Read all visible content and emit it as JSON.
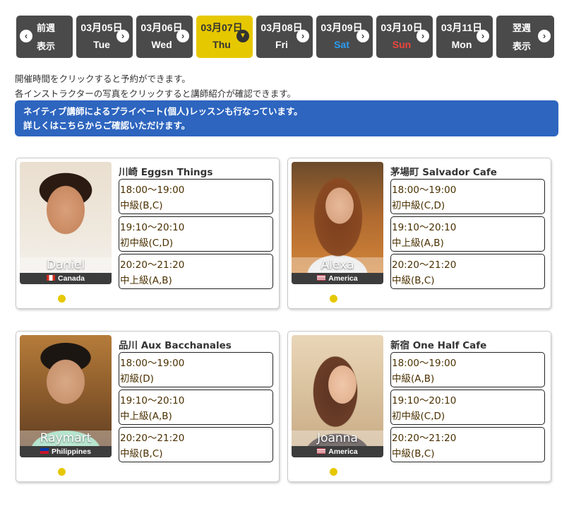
{
  "day_nav": [
    {
      "line1": "前週",
      "line2": "表示",
      "type": "prev"
    },
    {
      "line1": "03月05日",
      "line2": "Tue",
      "type": "day"
    },
    {
      "line1": "03月06日",
      "line2": "Wed",
      "type": "day"
    },
    {
      "line1": "03月07日",
      "line2": "Thu",
      "type": "active"
    },
    {
      "line1": "03月08日",
      "line2": "Fri",
      "type": "day"
    },
    {
      "line1": "03月09日",
      "line2": "Sat",
      "type": "sat"
    },
    {
      "line1": "03月10日",
      "line2": "Sun",
      "type": "sun"
    },
    {
      "line1": "03月11日",
      "line2": "Mon",
      "type": "day"
    },
    {
      "line1": "翌週",
      "line2": "表示",
      "type": "next"
    }
  ],
  "info": {
    "line1": "開催時間をクリックすると予約ができます。",
    "line2": "各インストラクターの写真をクリックすると講師紹介が確認できます。"
  },
  "banner": {
    "line1": "ネイティブ講師によるプライベート(個人)レッスンも行なっています。",
    "line2": "詳しくはこちらからご確認いただけます。"
  },
  "instructors": [
    {
      "name": "Daniel",
      "country": "Canada",
      "venue": "川崎 Eggsn Things",
      "slots": [
        {
          "time": "18:00〜19:00",
          "level": "中級(B,C)"
        },
        {
          "time": "19:10〜20:10",
          "level": "初中級(C,D)"
        },
        {
          "time": "20:20〜21:20",
          "level": "中上級(A,B)"
        }
      ]
    },
    {
      "name": "Alexa",
      "country": "America",
      "venue": "茅場町 Salvador Cafe",
      "slots": [
        {
          "time": "18:00〜19:00",
          "level": "初中級(C,D)"
        },
        {
          "time": "19:10〜20:10",
          "level": "中上級(A,B)"
        },
        {
          "time": "20:20〜21:20",
          "level": "中級(B,C)"
        }
      ]
    },
    {
      "name": "Raymart",
      "country": "Philippines",
      "venue": "品川 Aux Bacchanales",
      "slots": [
        {
          "time": "18:00〜19:00",
          "level": "初級(D)"
        },
        {
          "time": "19:10〜20:10",
          "level": "中上級(A,B)"
        },
        {
          "time": "20:20〜21:20",
          "level": "中級(B,C)"
        }
      ]
    },
    {
      "name": "Joanna",
      "country": "America",
      "venue": "新宿 One Half Cafe",
      "slots": [
        {
          "time": "18:00〜19:00",
          "level": "中級(A,B)"
        },
        {
          "time": "19:10〜20:10",
          "level": "初中級(C,D)"
        },
        {
          "time": "20:20〜21:20",
          "level": "中級(B,C)"
        }
      ]
    }
  ],
  "colors": {
    "nav_bg": "#4a4a4a",
    "active_bg": "#e6c800",
    "sat": "#2a9df4",
    "sun": "#f0453c",
    "banner": "#2d65bf",
    "dot": "#e6c800"
  },
  "icons": {
    "prev": "chevron-left-icon",
    "next": "chevron-right-icon",
    "active": "chevron-down-icon"
  }
}
